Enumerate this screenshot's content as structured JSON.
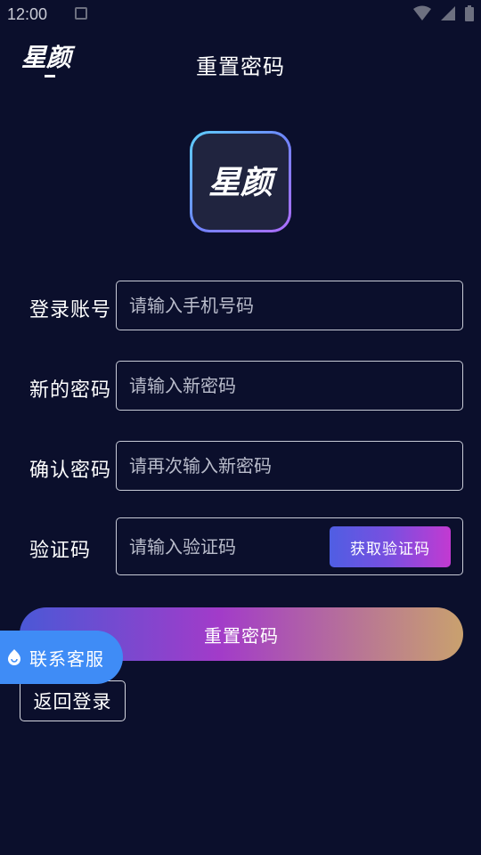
{
  "status_bar": {
    "time": "12:00"
  },
  "header": {
    "logo_text": "星颜",
    "title": "重置密码"
  },
  "app_logo": {
    "text": "星颜"
  },
  "form": {
    "account": {
      "label": "登录账号",
      "placeholder": "请输入手机号码",
      "value": ""
    },
    "new_password": {
      "label": "新的密码",
      "placeholder": "请输入新密码",
      "value": ""
    },
    "confirm_password": {
      "label": "确认密码",
      "placeholder": "请再次输入新密码",
      "value": ""
    },
    "code": {
      "label": "验证码",
      "placeholder": "请输入验证码",
      "value": "",
      "button_label": "获取验证码"
    }
  },
  "actions": {
    "reset_label": "重置密码",
    "back_label": "返回登录",
    "contact_label": "联系客服"
  },
  "colors": {
    "background": "#0b0f2c",
    "contact_blue": "#3f8cf6",
    "gradient_start": "#4b58d6",
    "gradient_end": "#c9a16e"
  }
}
